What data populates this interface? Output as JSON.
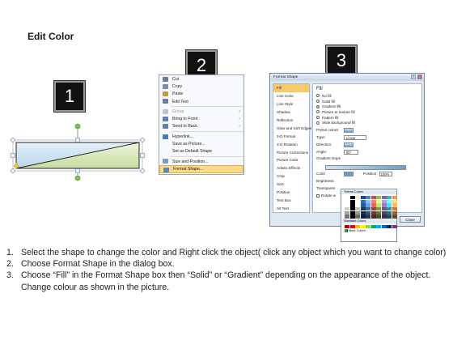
{
  "heading": "Edit Color",
  "step_badges": [
    "1",
    "2",
    "3"
  ],
  "context_menu": {
    "items": [
      {
        "label": "Cut",
        "icon": "scissors-icon",
        "color": "#6a7d9a"
      },
      {
        "label": "Copy",
        "icon": "copy-icon",
        "color": "#7a8fb0"
      },
      {
        "label": "Paste",
        "icon": "paste-icon",
        "color": "#c69a3c"
      },
      {
        "label": "Edit Text",
        "icon": "edit-text-icon",
        "color": "#6b7d99"
      },
      {
        "label": "Group",
        "icon": "group-icon",
        "color": "#b8c2d0",
        "submenu": true,
        "disabled": true
      },
      {
        "label": "Bring to Front",
        "icon": "bring-front-icon",
        "color": "#5f7fb0",
        "submenu": true
      },
      {
        "label": "Send to Back",
        "icon": "send-back-icon",
        "color": "#5f7fb0",
        "submenu": true
      },
      {
        "label": "Hyperlink...",
        "icon": "hyperlink-icon",
        "color": "#3f7fc0"
      },
      {
        "label": "Save as Picture...",
        "icon": "",
        "color": ""
      },
      {
        "label": "Set as Default Shape",
        "icon": "",
        "color": ""
      },
      {
        "label": "Size and Position...",
        "icon": "size-position-icon",
        "color": "#7a9cc4"
      },
      {
        "label": "Format Shape...",
        "icon": "format-shape-icon",
        "color": "#4d88c8",
        "highlighted": true
      }
    ]
  },
  "dialog": {
    "title": "Format Shape",
    "nav": [
      "Fill",
      "Line Color",
      "Line Style",
      "Shadow",
      "Reflection",
      "Glow and Soft Edges",
      "3-D Format",
      "3-D Rotation",
      "Picture Corrections",
      "Picture Color",
      "Artistic Effects",
      "Crop",
      "Size",
      "Position",
      "Text Box",
      "Alt Text"
    ],
    "panel_heading": "Fill",
    "fill_options": [
      "No fill",
      "Solid fill",
      "Gradient fill",
      "Picture or texture fill",
      "Pattern fill",
      "Slide background fill"
    ],
    "preset_label": "Preset colors:",
    "type_label": "Type:",
    "type_value": "Linear",
    "direction_label": "Direction:",
    "angle_label": "Angle:",
    "angle_value": "90°",
    "stops_label": "Gradient stops",
    "color_label": "Color",
    "position_label": "Position:",
    "position_value": "100%",
    "brightness_label": "Brightness",
    "transparency_label": "Transparen",
    "rotate_label": "Rotate w",
    "close_label": "Close"
  },
  "palette": {
    "theme_label": "Theme Colors",
    "standard_label": "Standard Colors",
    "more_label": "More Colors...",
    "theme_colors": [
      "#ffffff",
      "#000000",
      "#eeece1",
      "#1f497d",
      "#4f81bd",
      "#c0504d",
      "#9bbb59",
      "#8064a2",
      "#4bacc6",
      "#f79646"
    ],
    "standard_colors": [
      "#c00000",
      "#ff0000",
      "#ffc000",
      "#ffff00",
      "#92d050",
      "#00b050",
      "#00b0f0",
      "#0070c0",
      "#002060",
      "#7030a0"
    ]
  },
  "instructions": [
    {
      "num": "1.",
      "text": "Select the shape to change the color and Right click the object( click any object which you want to change color)"
    },
    {
      "num": "2.",
      "text": "Choose Format Shape in the dialog box."
    },
    {
      "num": "3.",
      "text": "Choose “Fill” in the Format Shape box then “Solid” or “Gradient” depending on the appearance of the object. Change colour as shown in the picture."
    }
  ]
}
